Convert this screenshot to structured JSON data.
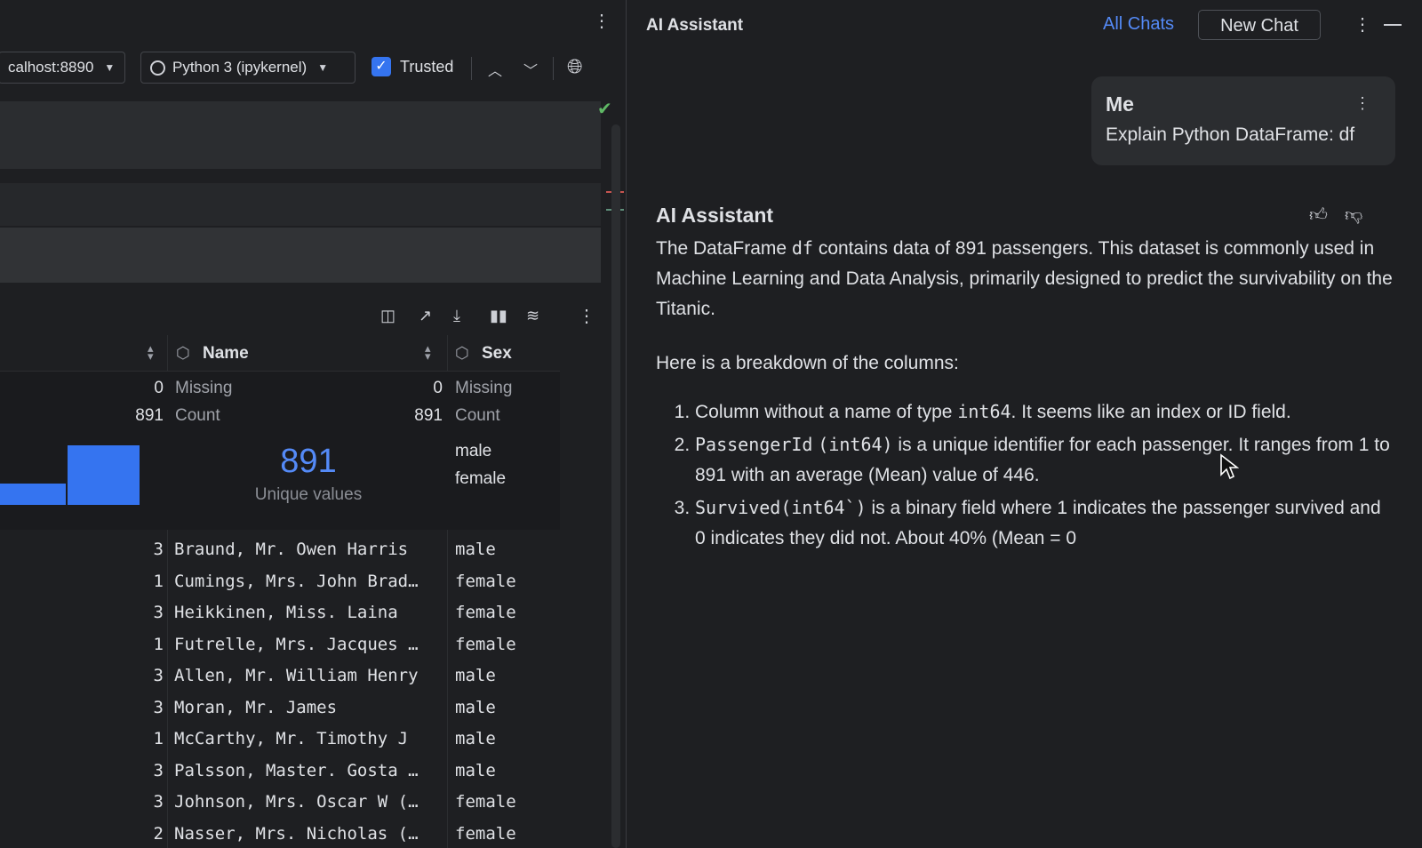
{
  "notebook": {
    "server_label": "calhost:8890",
    "kernel_label": "Python 3 (ipykernel)",
    "trusted_label": "Trusted",
    "trusted_checked": true
  },
  "dataframe": {
    "columns": [
      {
        "name": ""
      },
      {
        "name": "Name"
      },
      {
        "name": "Sex"
      }
    ],
    "stats": {
      "col0_missing": "0",
      "col0_count": "891",
      "name_missing_label": "Missing",
      "name_missing": "0",
      "name_count_label": "Count",
      "name_count": "891",
      "name_unique": "891",
      "name_unique_label": "Unique values",
      "sex_missing_label": "Missing",
      "sex_count_label": "Count",
      "sex_values": [
        "male",
        "female"
      ]
    },
    "rows": [
      {
        "pclass": "3",
        "name": "Braund, Mr. Owen Harris",
        "sex": "male"
      },
      {
        "pclass": "1",
        "name": "Cumings, Mrs. John Brad…",
        "sex": "female"
      },
      {
        "pclass": "3",
        "name": "Heikkinen, Miss. Laina",
        "sex": "female"
      },
      {
        "pclass": "1",
        "name": "Futrelle, Mrs. Jacques …",
        "sex": "female"
      },
      {
        "pclass": "3",
        "name": "Allen, Mr. William Henry",
        "sex": "male"
      },
      {
        "pclass": "3",
        "name": "Moran, Mr. James",
        "sex": "male"
      },
      {
        "pclass": "1",
        "name": "McCarthy, Mr. Timothy J",
        "sex": "male"
      },
      {
        "pclass": "3",
        "name": "Palsson, Master. Gosta …",
        "sex": "male"
      },
      {
        "pclass": "3",
        "name": "Johnson, Mrs. Oscar W (…",
        "sex": "female"
      },
      {
        "pclass": "2",
        "name": "Nasser, Mrs. Nicholas (…",
        "sex": "female"
      }
    ]
  },
  "assistant": {
    "panel_title": "AI Assistant",
    "all_chats": "All Chats",
    "new_chat": "New Chat",
    "user_name": "Me",
    "user_message": "Explain Python DataFrame: df",
    "ai_name": "AI Assistant",
    "para1_a": "The DataFrame ",
    "para1_code": "df",
    "para1_b": " contains data of 891 passengers. This dataset is commonly used in Machine Learning and Data Analysis, primarily designed to predict the survivability on the Titanic.",
    "para2": "Here is a breakdown of the columns:",
    "item1_a": "Column without a name of type ",
    "item1_code": "int64",
    "item1_b": ". It seems like an index or ID field.",
    "item2_code": "PassengerId",
    "item2_code2": "(int64)",
    "item2_b": " is a unique identifier for each passenger. It ranges from 1 to 891 with an average (Mean) value of 446.",
    "item3_code": "Survived(int64`)",
    "item3_b": " is a binary field where 1 indicates the passenger survived and 0 indicates they did not. About 40% (Mean = 0"
  },
  "colors": {
    "accent": "#3574f0",
    "link": "#548af7",
    "ok": "#5fb865"
  }
}
